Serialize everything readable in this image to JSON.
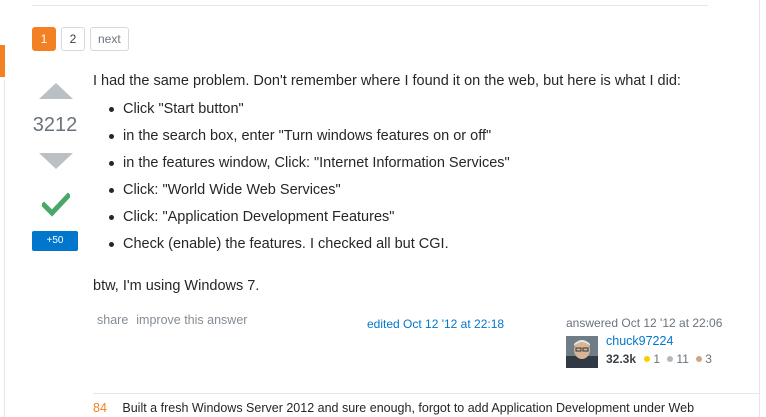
{
  "pagination": {
    "pages": [
      "1",
      "2"
    ],
    "current": "1",
    "next_label": "next"
  },
  "answer": {
    "score": "3212",
    "accepted": true,
    "bounty_label": "+50",
    "intro": "I had the same problem. Don't remember where I found it on the web, but here is what I did:",
    "steps": [
      "Click \"Start button\"",
      "in the search box, enter \"Turn windows features on or off\"",
      "in the features window, Click: \"Internet Information Services\"",
      "Click: \"World Wide Web Services\"",
      "Click: \"Application Development Features\"",
      "Check (enable) the features. I checked all but CGI."
    ],
    "outro": "btw, I'm using Windows 7.",
    "menu": {
      "share_label": "share",
      "improve_label": "improve this answer"
    },
    "edited_text": "edited Oct 12 '12 at 22:18",
    "answered_text": "answered Oct 12 '12 at 22:06",
    "author": {
      "name": "chuck97224",
      "reputation": "32.3k",
      "badges": {
        "gold": "1",
        "silver": "11",
        "bronze": "3"
      }
    }
  },
  "comment": {
    "score": "84",
    "text": "Built a fresh Windows Server 2012 and sure enough, forgot to add Application Development under Web"
  },
  "colors": {
    "accent_orange": "#f48024",
    "link_blue": "#0077cc",
    "accepted_green": "#48a868",
    "vote_gray": "#bbc0c4"
  },
  "icons": [
    "vote-up-icon",
    "vote-down-icon",
    "accepted-check-icon"
  ]
}
